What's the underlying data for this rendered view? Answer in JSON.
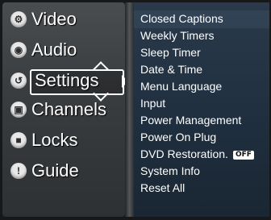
{
  "main_menu": [
    {
      "label": "Video",
      "icon": "gear-icon",
      "glyph": "⚙"
    },
    {
      "label": "Audio",
      "icon": "speaker-icon",
      "glyph": "◉"
    },
    {
      "label": "Settings",
      "icon": "settings-icon",
      "glyph": "↺",
      "selected": true
    },
    {
      "label": "Channels",
      "icon": "tv-icon",
      "glyph": "▣"
    },
    {
      "label": "Locks",
      "icon": "lock-icon",
      "glyph": "■"
    },
    {
      "label": "Guide",
      "icon": "info-icon",
      "glyph": "!"
    }
  ],
  "submenu": [
    {
      "label": "Closed Captions"
    },
    {
      "label": "Weekly Timers"
    },
    {
      "label": "Sleep Timer"
    },
    {
      "label": "Date & Time"
    },
    {
      "label": "Menu Language"
    },
    {
      "label": "Input"
    },
    {
      "label": "Power Management"
    },
    {
      "label": "Power On Plug"
    },
    {
      "label": "DVD Restoration.",
      "badge": "OFF"
    },
    {
      "label": "System Info"
    },
    {
      "label": "Reset All"
    }
  ]
}
